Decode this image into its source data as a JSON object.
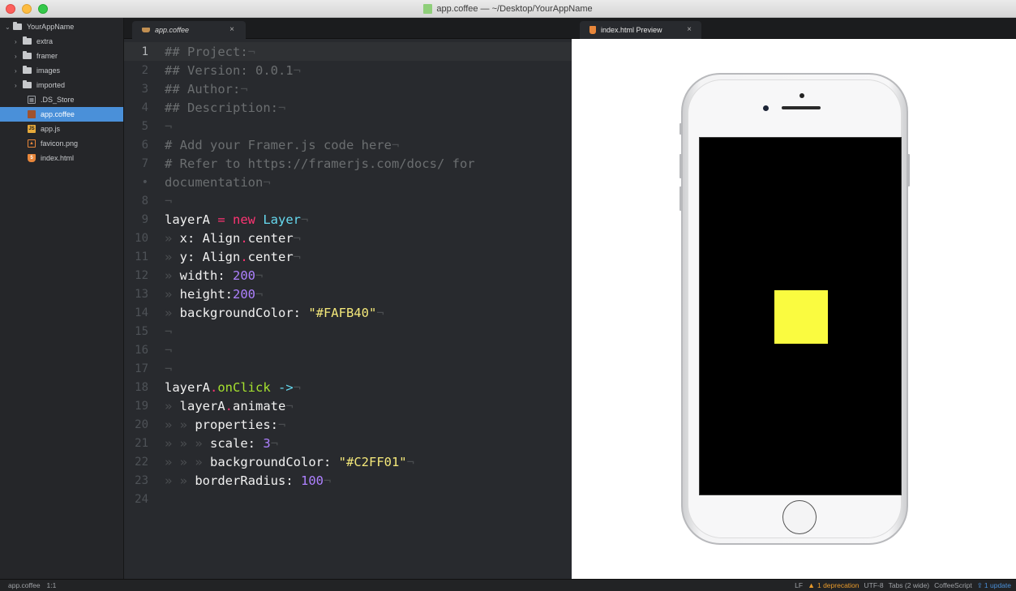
{
  "window": {
    "title": "app.coffee — ~/Desktop/YourAppName"
  },
  "tree": {
    "root": "YourAppName",
    "folders": [
      "extra",
      "framer",
      "images",
      "imported"
    ],
    "files": [
      {
        "name": ".DS_Store",
        "icon": "document-icon"
      },
      {
        "name": "app.coffee",
        "icon": "coffee-file-icon",
        "selected": true
      },
      {
        "name": "app.js",
        "icon": "js-file-icon"
      },
      {
        "name": "favicon.png",
        "icon": "image-file-icon"
      },
      {
        "name": "index.html",
        "icon": "html-file-icon"
      }
    ]
  },
  "editor": {
    "tab": {
      "label": "app.coffee",
      "close": "×"
    },
    "line_numbers": [
      "1",
      "2",
      "3",
      "4",
      "5",
      "6",
      "7",
      "•",
      "8",
      "9",
      "10",
      "11",
      "12",
      "13",
      "14",
      "15",
      "16",
      "17",
      "18",
      "19",
      "20",
      "21",
      "22",
      "23",
      "24"
    ]
  },
  "preview": {
    "tab": {
      "label": "index.html Preview",
      "close": "×"
    },
    "layer": {
      "backgroundColor": "#FAFB40"
    }
  },
  "statusbar": {
    "file": "app.coffee",
    "cursor": "1:1",
    "line_ending": "LF",
    "deprecation": "1 deprecation",
    "encoding": "UTF-8",
    "tabs": "Tabs (2 wide)",
    "grammar": "CoffeeScript",
    "update": "1 update"
  },
  "code": {
    "l1_text": "## Project:",
    "l2_text": "## Version: 0.0.1",
    "l3_text": "## Author:",
    "l4_text": "## Description:",
    "l6_text": "# Add your Framer.js code here",
    "l7_text": "# Refer to https://framerjs.com/docs/ for",
    "l7b_text": "documentation",
    "l9_var": "layerA",
    "l9_eq": " = ",
    "l9_new": "new",
    "l9_cls": "Layer",
    "l10_key": "x: Align",
    "l10_prop": "center",
    "l11_key": "y: Align",
    "l11_prop": "center",
    "l12_key": "width: ",
    "l12_val": "200",
    "l13_key": "height:",
    "l13_val": "200",
    "l14_key": "backgroundColor: ",
    "l14_val": "\"#FAFB40\"",
    "l18_var": "layerA",
    "l18_fn": "onClick",
    "l18_arrow": " ->",
    "l19_var": "layerA",
    "l19_fn": "animate",
    "l20_key": "properties:",
    "l21_key": "scale: ",
    "l21_val": "3",
    "l22_key": "backgroundColor: ",
    "l22_val": "\"#C2FF01\"",
    "l23_key": "borderRadius: ",
    "l23_val": "100",
    "eol": "¬",
    "dot": ".",
    "indent": "» "
  },
  "colors": {
    "accent": "#4a90d9",
    "warning": "#e89a2b",
    "keyword": "#ff3473",
    "string": "#f4e87a",
    "number": "#ae81ff"
  }
}
